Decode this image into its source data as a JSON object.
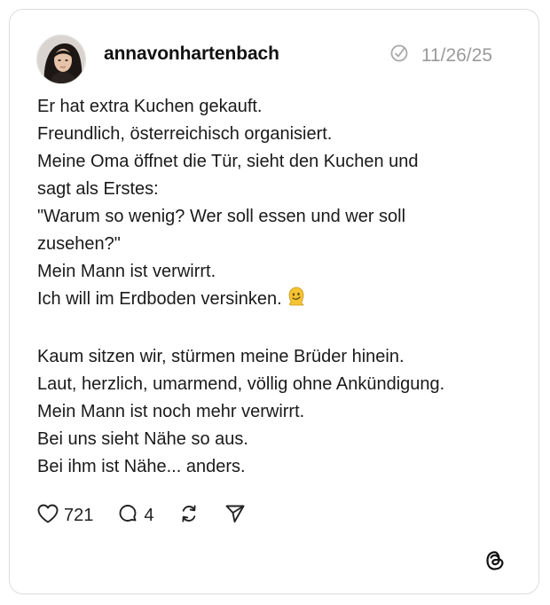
{
  "post": {
    "username": "annavonhartenbach",
    "date": "11/26/25",
    "lines": [
      "Er hat extra Kuchen gekauft.",
      "Freundlich, österreichisch organisiert.",
      "Meine Oma öffnet die Tür, sieht den Kuchen und",
      "sagt als Erstes:",
      "\"Warum so wenig? Wer soll essen und wer soll",
      "zusehen?\"",
      "Mein Mann ist verwirrt.",
      "Ich will im Erdboden versinken.",
      "",
      "Kaum sitzen wir, stürmen meine Brüder hinein.",
      "Laut, herzlich, umarmend, völlig ohne Ankündigung.",
      "Mein Mann ist noch mehr verwirrt.",
      "Bei uns sieht Nähe so aus.",
      "Bei ihm ist Nähe... anders."
    ]
  },
  "actions": {
    "likes": "721",
    "comments": "4"
  },
  "icons": {
    "verified": "check-circle-icon",
    "like": "heart-icon",
    "comment": "comment-icon",
    "repost": "repost-icon",
    "share": "send-icon",
    "brand": "threads-logo-icon",
    "emoji": "melting-face-emoji"
  },
  "colors": {
    "text": "#1a1a1a",
    "muted": "#9a9a9a",
    "border": "#dcdcdc",
    "emoji": "#f5c431"
  }
}
